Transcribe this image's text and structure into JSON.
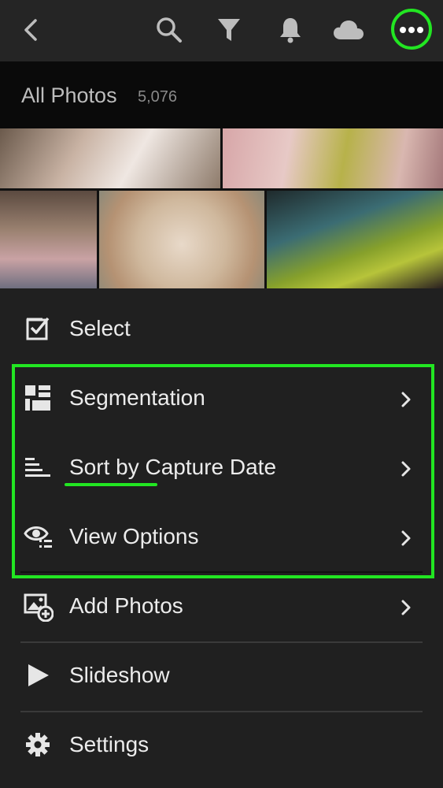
{
  "album": {
    "title": "All Photos",
    "count": "5,076"
  },
  "toolbar": {
    "icons": [
      "back-icon",
      "search-icon",
      "filter-icon",
      "bell-icon",
      "cloud-icon",
      "more-icon"
    ]
  },
  "menu": {
    "items": [
      {
        "label": "Select",
        "icon": "checkbox-icon",
        "has_chevron": false
      },
      {
        "label": "Segmentation",
        "icon": "segmentation-icon",
        "has_chevron": true
      },
      {
        "label": "Sort by Capture Date",
        "icon": "sort-icon",
        "has_chevron": true
      },
      {
        "label": "View Options",
        "icon": "view-options-icon",
        "has_chevron": true
      },
      {
        "label": "Add Photos",
        "icon": "add-photos-icon",
        "has_chevron": true
      },
      {
        "label": "Slideshow",
        "icon": "play-icon",
        "has_chevron": false
      },
      {
        "label": "Settings",
        "icon": "gear-icon",
        "has_chevron": false
      }
    ]
  },
  "colors": {
    "highlight": "#22e622",
    "background": "#202020",
    "header": "#0a0a0a"
  }
}
